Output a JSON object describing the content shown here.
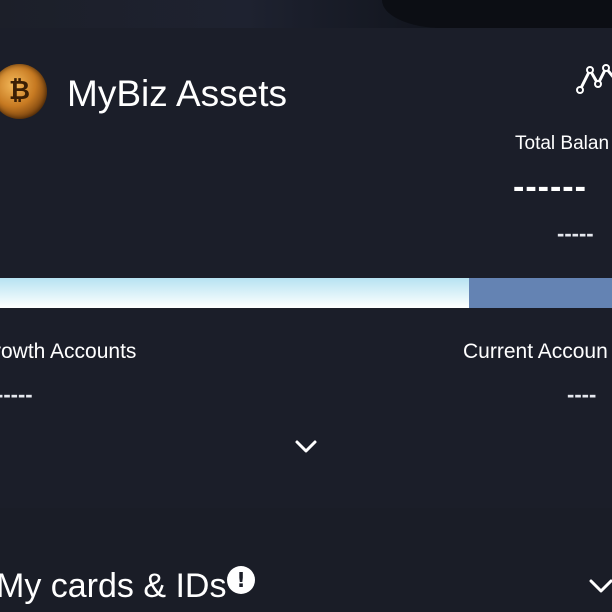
{
  "header": {
    "coin_icon": "bitcoin-coin-icon",
    "coin_glyph": "₿",
    "title": "MyBiz Assets",
    "trend_icon": "trend-line-icon"
  },
  "balance": {
    "label": "Total Balan",
    "value": "------",
    "sub_value": "-----"
  },
  "allocation": {
    "growth_fraction": 0.766,
    "growth_color": "#e9f7fb",
    "current_color": "#6483b3"
  },
  "accounts": {
    "growth_label": "rowth Accounts",
    "growth_value": "-----",
    "current_label": "Current Accoun",
    "current_value": "----"
  },
  "expand_icon": "chevron-down-icon",
  "cards_section": {
    "title": "My cards & IDs",
    "alert_icon": "exclamation-circle-icon",
    "alert_glyph": "!",
    "chevron_icon": "chevron-down-icon"
  },
  "colors": {
    "background": "#1a1d27",
    "text": "#ffffff"
  }
}
